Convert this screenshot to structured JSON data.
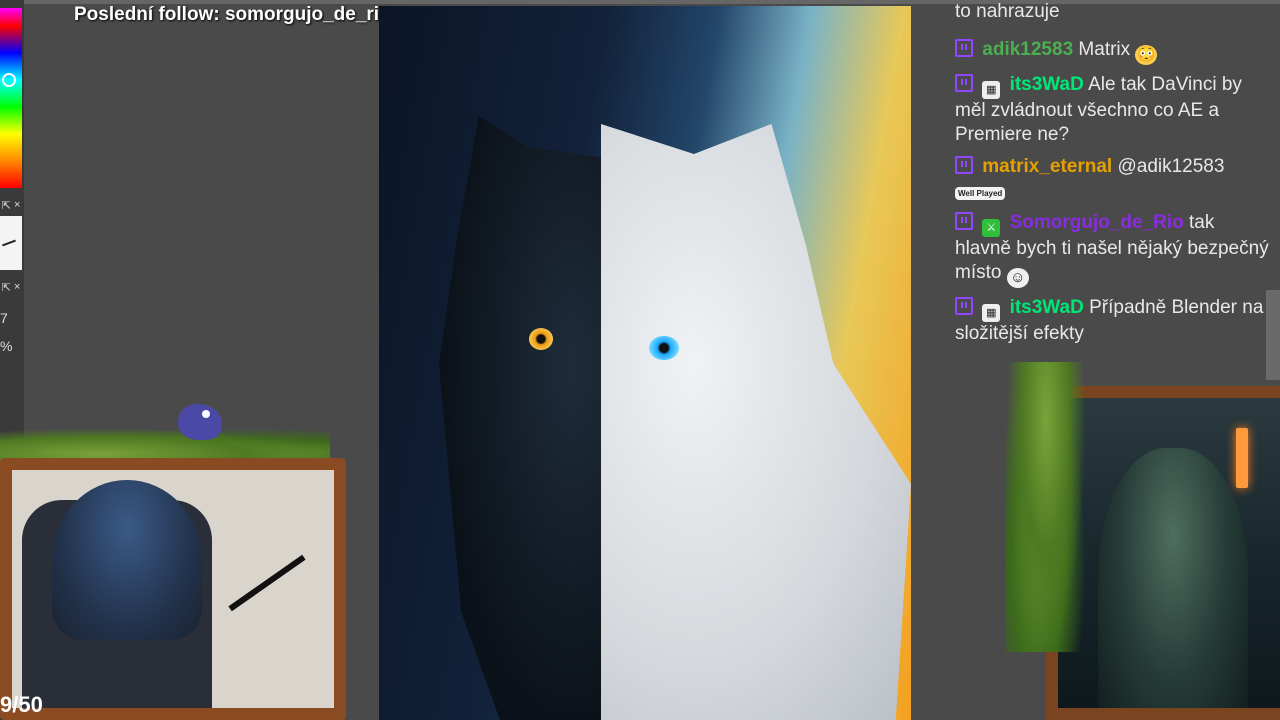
{
  "overlay": {
    "last_follow": "Poslední follow: somorgujo_de_rio",
    "counter": "9/50"
  },
  "toolbar": {
    "num_7": "7",
    "percent": "%"
  },
  "chat": {
    "partial_line": "to nahrazuje",
    "messages": [
      {
        "user": "adik12583",
        "text": "Matrix",
        "user_color": "#4caf50"
      },
      {
        "user": "its3WaD",
        "text": "Ale tak DaVinci by měl zvládnout všechno co AE a Premiere ne?",
        "user_color": "#00e676"
      },
      {
        "user": "matrix_eternal",
        "text": "@adik12583",
        "user_color": "#e6a100"
      },
      {
        "user": "Somorgujo_de_Rio",
        "text": "tak hlavně bych ti našel nějaký bezpečný místo",
        "user_color": "#8a2be2"
      },
      {
        "user": "its3WaD",
        "text": "Případně Blender na složitější efekty",
        "user_color": "#00e676"
      }
    ],
    "sticker_text": "Well Played"
  },
  "colors": {
    "twitch_purple": "#9146ff",
    "frame_wood": "#8a4a22"
  }
}
